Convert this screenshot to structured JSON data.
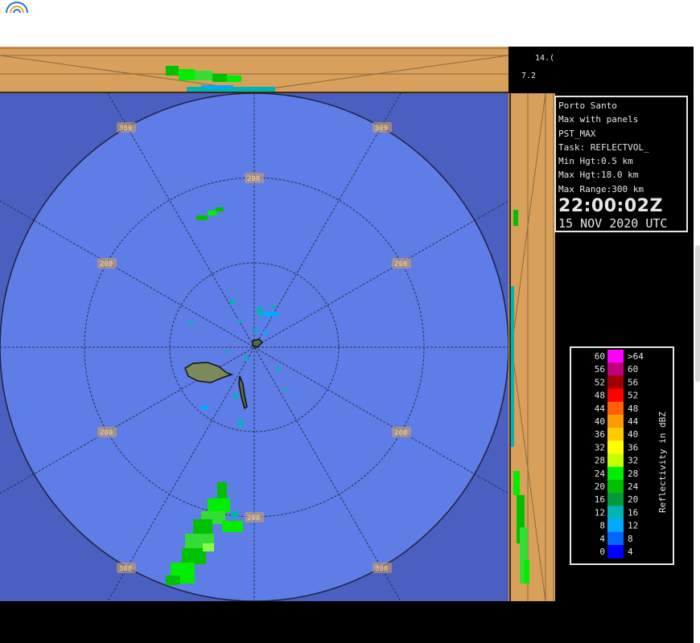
{
  "info": {
    "station": "Porto Santo",
    "product": "Max with panels",
    "code": "PST_MAX",
    "task": "Task: REFLECTVOL_",
    "min_hgt": "Min Hgt:0.5 km",
    "max_hgt": "Max Hgt:18.0 km",
    "max_range": "Max Range:300 km",
    "time": "22:00:02Z",
    "date": "15 NOV 2020 UTC"
  },
  "height_axis": {
    "top": "14.(",
    "mid": "7.2"
  },
  "range_labels": {
    "outer": "300",
    "middle": "200",
    "inner": "200"
  },
  "legend": {
    "title": "Reflectivity in dBZ",
    "left": [
      "60",
      "56",
      "52",
      "48",
      "44",
      "40",
      "36",
      "32",
      "28",
      "24",
      "20",
      "16",
      "12",
      "8",
      "4",
      "0"
    ],
    "right": [
      ">64",
      "60",
      "56",
      "52",
      "48",
      "44",
      "40",
      "36",
      "32",
      "28",
      "24",
      "20",
      "16",
      "12",
      "8",
      "4"
    ],
    "colors": [
      "#ff00ff",
      "#c0007a",
      "#a00000",
      "#ff0000",
      "#ff6000",
      "#ff9900",
      "#ffcc00",
      "#ffff00",
      "#c8ff00",
      "#00ee00",
      "#00c000",
      "#009a3a",
      "#00b4b4",
      "#00aaff",
      "#0066ff",
      "#0000ff"
    ]
  },
  "colors": {
    "panel_tan": "#d9a05b",
    "ppi_bg": "#4a5fc0",
    "circle": "#5e7de6",
    "rings": "#2a2f4a"
  }
}
